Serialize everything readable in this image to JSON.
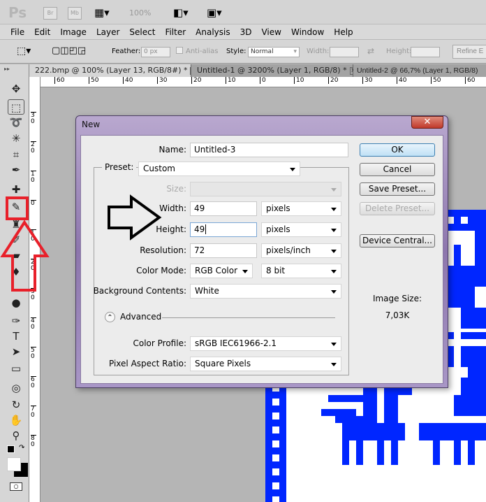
{
  "app": {
    "logo": "Ps",
    "bridge": "Br",
    "mini_bridge": "Mb",
    "zoom": "100%"
  },
  "menu": [
    "File",
    "Edit",
    "Image",
    "Layer",
    "Select",
    "Filter",
    "Analysis",
    "3D",
    "View",
    "Window",
    "Help"
  ],
  "options": {
    "feather_label": "Feather:",
    "feather_value": "0 px",
    "anti_alias": "Anti-alias",
    "style_label": "Style:",
    "style_value": "Normal",
    "width_label": "Width:",
    "height_label": "Height:",
    "refine_edge": "Refine E"
  },
  "tabs": [
    {
      "label": "222.bmp @ 100% (Layer 13, RGB/8#) *",
      "close": "×"
    },
    {
      "label": "Untitled-1 @ 3200% (Layer 1, RGB/8) *",
      "close": "×"
    },
    {
      "label": "Untitled-2 @ 66,7% (Layer 1, RGB/8)",
      "close": ""
    }
  ],
  "hruler": [
    "60",
    "50",
    "40",
    "30",
    "20",
    "10",
    "0",
    "10",
    "20",
    "30",
    "40",
    "50",
    "60"
  ],
  "vruler": [
    "3 0",
    "2 0",
    "1 0",
    "0",
    "1 0",
    "2 0",
    "3 0",
    "4 0",
    "5 0",
    "6 0",
    "7 0",
    "8 0"
  ],
  "tools": [
    {
      "name": "move-tool",
      "glyph": "✥"
    },
    {
      "name": "marquee-tool",
      "glyph": "⬚"
    },
    {
      "name": "lasso-tool",
      "glyph": "➰"
    },
    {
      "name": "magic-wand-tool",
      "glyph": "✳"
    },
    {
      "name": "crop-tool",
      "glyph": "⌗"
    },
    {
      "name": "eyedropper-tool",
      "glyph": "✒"
    },
    {
      "name": "healing-brush-tool",
      "glyph": "✚"
    },
    {
      "name": "pencil-tool",
      "glyph": "✎"
    },
    {
      "name": "clone-stamp-tool",
      "glyph": "♜"
    },
    {
      "name": "history-brush-tool",
      "glyph": "✐"
    },
    {
      "name": "eraser-tool",
      "glyph": "▰"
    },
    {
      "name": "paint-bucket-tool",
      "glyph": "♦"
    },
    {
      "name": "dodge-tool",
      "glyph": "●"
    },
    {
      "name": "pen-tool",
      "glyph": "✑"
    },
    {
      "name": "type-tool",
      "glyph": "T"
    },
    {
      "name": "path-selection-tool",
      "glyph": "➤"
    },
    {
      "name": "rectangle-tool",
      "glyph": "▭"
    },
    {
      "name": "3d-rotate-tool",
      "glyph": "◎"
    },
    {
      "name": "3d-orbit-tool",
      "glyph": "↻"
    },
    {
      "name": "hand-tool",
      "glyph": "✋"
    },
    {
      "name": "zoom-tool",
      "glyph": "⚲"
    }
  ],
  "dialog": {
    "title": "New",
    "close": "✕",
    "name_label": "Name:",
    "name_value": "Untitled-3",
    "preset_label": "Preset:",
    "preset_value": "Custom",
    "size_label": "Size:",
    "width_label": "Width:",
    "width_value": "49",
    "width_unit": "pixels",
    "height_label": "Height:",
    "height_value": "49",
    "height_unit": "pixels",
    "resolution_label": "Resolution:",
    "resolution_value": "72",
    "resolution_unit": "pixels/inch",
    "color_mode_label": "Color Mode:",
    "color_mode_value": "RGB Color",
    "bit_depth": "8 bit",
    "background_label": "Background Contents:",
    "background_value": "White",
    "advanced": "Advanced",
    "advanced_icon": "⌃",
    "color_profile_label": "Color Profile:",
    "color_profile_value": "sRGB IEC61966-2.1",
    "pixel_aspect_label": "Pixel Aspect Ratio:",
    "pixel_aspect_value": "Square Pixels",
    "ok": "OK",
    "cancel": "Cancel",
    "save_preset": "Save Preset...",
    "delete_preset": "Delete Preset...",
    "device_central": "Device Central...",
    "image_size_label": "Image Size:",
    "image_size_value": "7,03K"
  },
  "colors": {
    "accent_blue": "#0026ff",
    "annotation_red": "#e8202a"
  }
}
